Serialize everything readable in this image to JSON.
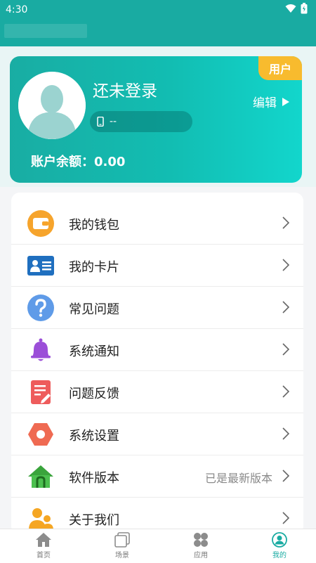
{
  "status_bar": {
    "time": "4:30"
  },
  "colors": {
    "accent": "#19aba2",
    "badge": "#f8bb2e"
  },
  "profile": {
    "role_badge": "用户",
    "name": "还未登录",
    "phone": "--",
    "edit_label": "编辑",
    "balance": "账户余额：0.00"
  },
  "menu": {
    "items": [
      {
        "label": "我的钱包",
        "icon": "wallet-icon",
        "value": ""
      },
      {
        "label": "我的卡片",
        "icon": "card-icon",
        "value": ""
      },
      {
        "label": "常见问题",
        "icon": "question-icon",
        "value": ""
      },
      {
        "label": "系统通知",
        "icon": "bell-icon",
        "value": ""
      },
      {
        "label": "问题反馈",
        "icon": "feedback-icon",
        "value": ""
      },
      {
        "label": "系统设置",
        "icon": "settings-icon",
        "value": ""
      },
      {
        "label": "软件版本",
        "icon": "home-version-icon",
        "value": "已是最新版本"
      },
      {
        "label": "关于我们",
        "icon": "about-users-icon",
        "value": ""
      }
    ]
  },
  "bottom_nav": {
    "items": [
      {
        "label": "首页",
        "icon": "home-icon"
      },
      {
        "label": "场景",
        "icon": "scene-icon"
      },
      {
        "label": "应用",
        "icon": "apps-icon"
      },
      {
        "label": "我的",
        "icon": "profile-icon"
      }
    ],
    "active": "我的"
  }
}
